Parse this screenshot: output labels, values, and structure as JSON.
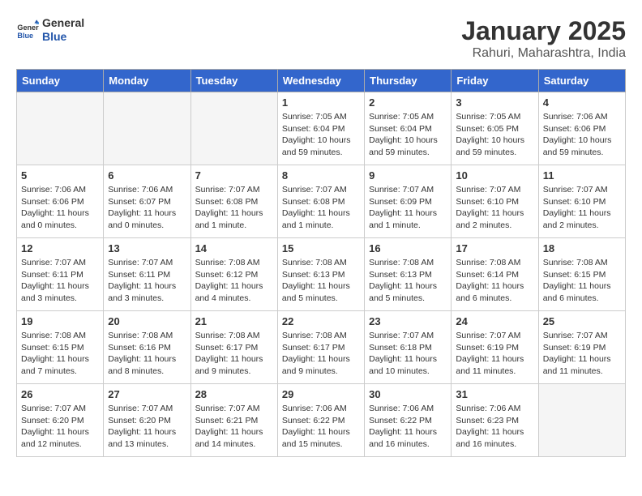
{
  "header": {
    "logo_general": "General",
    "logo_blue": "Blue",
    "month_title": "January 2025",
    "location": "Rahuri, Maharashtra, India"
  },
  "calendar": {
    "weekdays": [
      "Sunday",
      "Monday",
      "Tuesday",
      "Wednesday",
      "Thursday",
      "Friday",
      "Saturday"
    ],
    "weeks": [
      [
        {
          "day": "",
          "empty": true
        },
        {
          "day": "",
          "empty": true
        },
        {
          "day": "",
          "empty": true
        },
        {
          "day": "1",
          "sunrise": "7:05 AM",
          "sunset": "6:04 PM",
          "daylight": "10 hours and 59 minutes."
        },
        {
          "day": "2",
          "sunrise": "7:05 AM",
          "sunset": "6:04 PM",
          "daylight": "10 hours and 59 minutes."
        },
        {
          "day": "3",
          "sunrise": "7:05 AM",
          "sunset": "6:05 PM",
          "daylight": "10 hours and 59 minutes."
        },
        {
          "day": "4",
          "sunrise": "7:06 AM",
          "sunset": "6:06 PM",
          "daylight": "10 hours and 59 minutes."
        }
      ],
      [
        {
          "day": "5",
          "sunrise": "7:06 AM",
          "sunset": "6:06 PM",
          "daylight": "11 hours and 0 minutes."
        },
        {
          "day": "6",
          "sunrise": "7:06 AM",
          "sunset": "6:07 PM",
          "daylight": "11 hours and 0 minutes."
        },
        {
          "day": "7",
          "sunrise": "7:07 AM",
          "sunset": "6:08 PM",
          "daylight": "11 hours and 1 minute."
        },
        {
          "day": "8",
          "sunrise": "7:07 AM",
          "sunset": "6:08 PM",
          "daylight": "11 hours and 1 minute."
        },
        {
          "day": "9",
          "sunrise": "7:07 AM",
          "sunset": "6:09 PM",
          "daylight": "11 hours and 1 minute."
        },
        {
          "day": "10",
          "sunrise": "7:07 AM",
          "sunset": "6:10 PM",
          "daylight": "11 hours and 2 minutes."
        },
        {
          "day": "11",
          "sunrise": "7:07 AM",
          "sunset": "6:10 PM",
          "daylight": "11 hours and 2 minutes."
        }
      ],
      [
        {
          "day": "12",
          "sunrise": "7:07 AM",
          "sunset": "6:11 PM",
          "daylight": "11 hours and 3 minutes."
        },
        {
          "day": "13",
          "sunrise": "7:07 AM",
          "sunset": "6:11 PM",
          "daylight": "11 hours and 3 minutes."
        },
        {
          "day": "14",
          "sunrise": "7:08 AM",
          "sunset": "6:12 PM",
          "daylight": "11 hours and 4 minutes."
        },
        {
          "day": "15",
          "sunrise": "7:08 AM",
          "sunset": "6:13 PM",
          "daylight": "11 hours and 5 minutes."
        },
        {
          "day": "16",
          "sunrise": "7:08 AM",
          "sunset": "6:13 PM",
          "daylight": "11 hours and 5 minutes."
        },
        {
          "day": "17",
          "sunrise": "7:08 AM",
          "sunset": "6:14 PM",
          "daylight": "11 hours and 6 minutes."
        },
        {
          "day": "18",
          "sunrise": "7:08 AM",
          "sunset": "6:15 PM",
          "daylight": "11 hours and 6 minutes."
        }
      ],
      [
        {
          "day": "19",
          "sunrise": "7:08 AM",
          "sunset": "6:15 PM",
          "daylight": "11 hours and 7 minutes."
        },
        {
          "day": "20",
          "sunrise": "7:08 AM",
          "sunset": "6:16 PM",
          "daylight": "11 hours and 8 minutes."
        },
        {
          "day": "21",
          "sunrise": "7:08 AM",
          "sunset": "6:17 PM",
          "daylight": "11 hours and 9 minutes."
        },
        {
          "day": "22",
          "sunrise": "7:08 AM",
          "sunset": "6:17 PM",
          "daylight": "11 hours and 9 minutes."
        },
        {
          "day": "23",
          "sunrise": "7:07 AM",
          "sunset": "6:18 PM",
          "daylight": "11 hours and 10 minutes."
        },
        {
          "day": "24",
          "sunrise": "7:07 AM",
          "sunset": "6:19 PM",
          "daylight": "11 hours and 11 minutes."
        },
        {
          "day": "25",
          "sunrise": "7:07 AM",
          "sunset": "6:19 PM",
          "daylight": "11 hours and 11 minutes."
        }
      ],
      [
        {
          "day": "26",
          "sunrise": "7:07 AM",
          "sunset": "6:20 PM",
          "daylight": "11 hours and 12 minutes."
        },
        {
          "day": "27",
          "sunrise": "7:07 AM",
          "sunset": "6:20 PM",
          "daylight": "11 hours and 13 minutes."
        },
        {
          "day": "28",
          "sunrise": "7:07 AM",
          "sunset": "6:21 PM",
          "daylight": "11 hours and 14 minutes."
        },
        {
          "day": "29",
          "sunrise": "7:06 AM",
          "sunset": "6:22 PM",
          "daylight": "11 hours and 15 minutes."
        },
        {
          "day": "30",
          "sunrise": "7:06 AM",
          "sunset": "6:22 PM",
          "daylight": "11 hours and 16 minutes."
        },
        {
          "day": "31",
          "sunrise": "7:06 AM",
          "sunset": "6:23 PM",
          "daylight": "11 hours and 16 minutes."
        },
        {
          "day": "",
          "empty": true
        }
      ]
    ]
  }
}
